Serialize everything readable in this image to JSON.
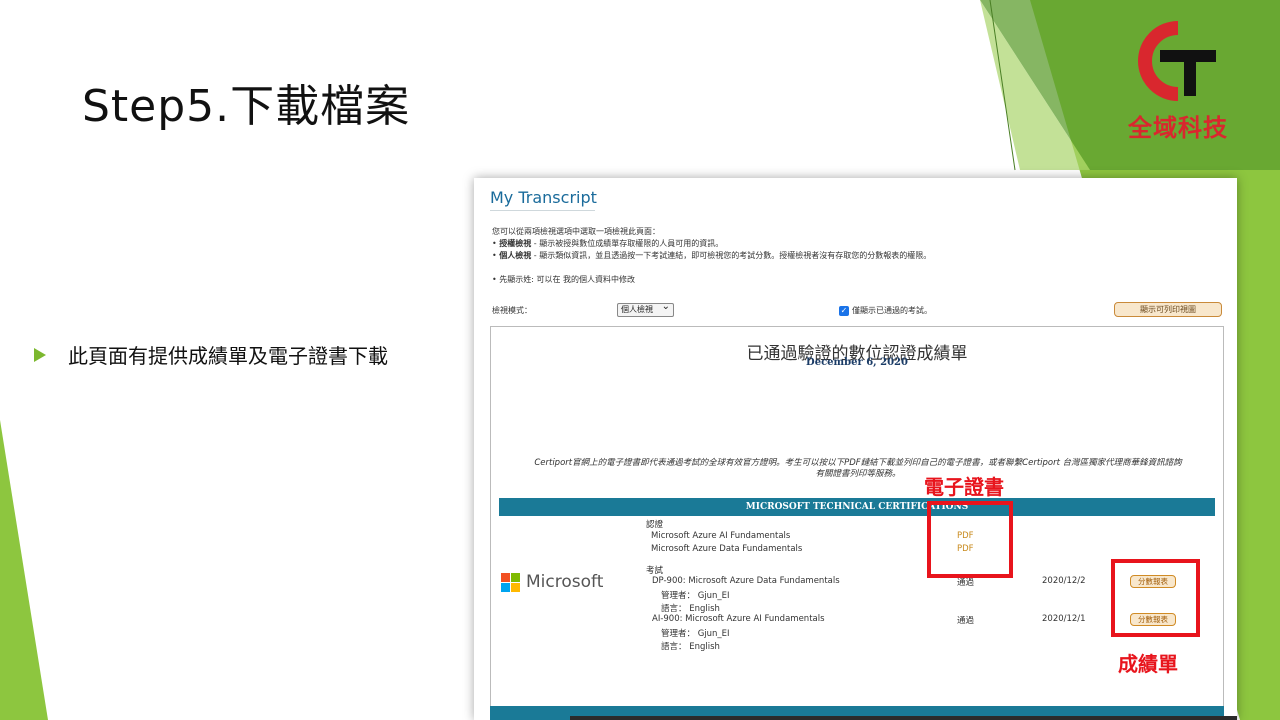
{
  "slide": {
    "title": "Step5.下載檔案",
    "bullet": "此頁面有提供成績單及電子證書下載"
  },
  "logo": {
    "text": "全域科技",
    "icon": "ct-logo-icon",
    "accent": "#d9272e"
  },
  "screenshot": {
    "heading": "My Transcript",
    "intro": "您可以從兩項檢視選項中選取一項檢視此頁面：",
    "items": [
      {
        "label": "授權檢視",
        "text": " - 顯示被授與數位成績單存取權限的人員可用的資訊。"
      },
      {
        "label": "個人檢視",
        "text": " - 顯示類似資訊，並且透過按一下考試連結，即可檢視您的考試分數。授權檢視者沒有存取您的分數報表的權限。"
      }
    ],
    "note": "先顯示姓: 可以在 我的個人資料中修改",
    "mode_label": "檢視模式：",
    "mode_value": "個人檢視",
    "checkbox_label": "僅顯示已通過的考試。",
    "print_button": "顯示可列印視圖",
    "doc": {
      "title": "已通過驗證的數位認證成績單",
      "date": "December 6, 2020",
      "desc_line1": "Certiport官網上的電子證書即代表通過考試的全球有效官方證明。考生可以按以下PDF鏈結下載並列印自己的電子證書，或者聯繫Certiport 台灣區獨家代理商華鋒資訊諮詢",
      "desc_line2": "有關證書列印等服務。",
      "banner": "MICROSOFT TECHNICAL CERTIFICATIONS",
      "vendor": "Microsoft",
      "cert_section": "認證",
      "certs": [
        {
          "name": "Microsoft Azure AI Fundamentals",
          "link": "PDF"
        },
        {
          "name": "Microsoft Azure Data Fundamentals",
          "link": "PDF"
        }
      ],
      "exam_section": "考試",
      "exams": [
        {
          "name": "DP-900: Microsoft Azure Data Fundamentals",
          "admin": "管理者： Gjun_EI",
          "lang": "語言： English",
          "status": "通過",
          "date": "2020/12/2",
          "button": "分數報表"
        },
        {
          "name": "AI-900: Microsoft Azure AI Fundamentals",
          "admin": "管理者： Gjun_EI",
          "lang": "語言： English",
          "status": "通過",
          "date": "2020/12/1",
          "button": "分數報表"
        }
      ]
    }
  },
  "annotations": {
    "certificate_label": "電子證書",
    "transcript_label": "成績單",
    "color": "#e8141c"
  }
}
